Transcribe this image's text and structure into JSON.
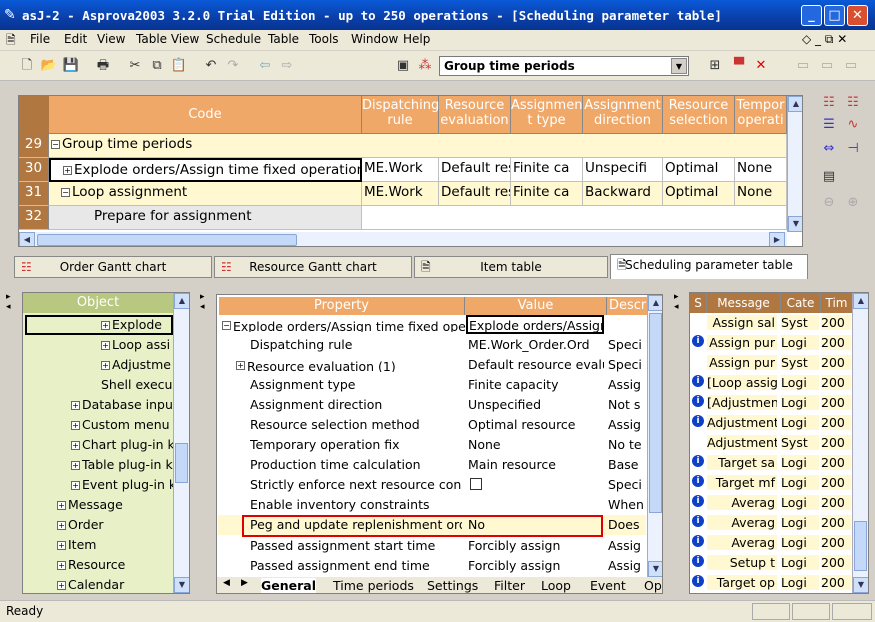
{
  "window": {
    "title": "asJ-2 - Asprova2003 3.2.0 Trial Edition  - up to 250 operations - [Scheduling parameter table]"
  },
  "menu": [
    "File",
    "Edit",
    "View",
    "Table View",
    "Schedule",
    "Table",
    "Tools",
    "Window",
    "Help"
  ],
  "toolbar": {
    "group_select": "Group time periods"
  },
  "top_grid": {
    "headers": [
      "Code",
      "Dispatching rule",
      "Resource evaluation",
      "Assignmen t type",
      "Assignment direction",
      "Resource selection",
      "Tempor operati"
    ],
    "rows": [
      {
        "num": "29",
        "code": "Group time periods",
        "cells": [
          "",
          "",
          "",
          "",
          "",
          ""
        ]
      },
      {
        "num": "30",
        "code": "Explode orders/Assign time fixed operations",
        "cells": [
          "ME.Work",
          "Default res",
          "Finite ca",
          "Unspecifi",
          "Optimal",
          "None"
        ]
      },
      {
        "num": "31",
        "code": "Loop assignment",
        "cells": [
          "ME.Work",
          "Default res",
          "Finite ca",
          "Backward",
          "Optimal",
          "None"
        ]
      },
      {
        "num": "32",
        "code": "Prepare for assignment",
        "cells": [
          "",
          "",
          "",
          "",
          "",
          ""
        ]
      }
    ]
  },
  "tabs": [
    "Order Gantt chart",
    "Resource Gantt chart",
    "Item table",
    "Scheduling parameter table"
  ],
  "object_tree": {
    "header": "Object",
    "items": [
      "Explode",
      "Loop assi",
      "Adjustme",
      "Shell execu",
      "Database inpu",
      "Custom menu",
      "Chart plug-in k",
      "Table plug-in k",
      "Event plug-in k",
      "Message",
      "Order",
      "Item",
      "Resource",
      "Calendar"
    ]
  },
  "property_grid": {
    "headers": [
      "Property",
      "Value",
      "Descr"
    ],
    "rows": [
      {
        "prop": "Explode orders/Assign time fixed opera",
        "value": "Explode orders/Assign",
        "desc": ""
      },
      {
        "prop": "Dispatching rule",
        "value": "ME.Work_Order.Ord",
        "desc": "Speci"
      },
      {
        "prop": "Resource evaluation (1)",
        "value": "Default resource evalua",
        "desc": "Speci"
      },
      {
        "prop": "Assignment type",
        "value": "Finite capacity",
        "desc": "Assig"
      },
      {
        "prop": "Assignment direction",
        "value": "Unspecified",
        "desc": "Not s"
      },
      {
        "prop": "Resource selection method",
        "value": "Optimal resource",
        "desc": "Assig"
      },
      {
        "prop": "Temporary operation fix",
        "value": "None",
        "desc": "No te"
      },
      {
        "prop": "Production time calculation",
        "value": "Main resource",
        "desc": "Base"
      },
      {
        "prop": "Strictly enforce next resource constr",
        "value": "",
        "desc": "Speci"
      },
      {
        "prop": "Enable inventory constraints",
        "value": "",
        "desc": "When"
      },
      {
        "prop": "Peg and update replenishment order",
        "value": "No",
        "desc": "Does"
      },
      {
        "prop": "Passed assignment start time",
        "value": "Forcibly assign",
        "desc": "Assig"
      },
      {
        "prop": "Passed assignment end time",
        "value": "Forcibly assign",
        "desc": "Assig"
      }
    ],
    "tabs": [
      "General",
      "Time periods",
      "Settings",
      "Filter",
      "Loop",
      "Event",
      "Op"
    ]
  },
  "messages": {
    "headers": [
      "S",
      "Message",
      "Cate",
      "Tim"
    ],
    "rows": [
      {
        "info": false,
        "msg": "Assign sal",
        "cat": "Syst",
        "time": "200"
      },
      {
        "info": true,
        "msg": "Assign pur",
        "cat": "Logi",
        "time": "200"
      },
      {
        "info": false,
        "msg": "Assign pur",
        "cat": "Syst",
        "time": "200"
      },
      {
        "info": true,
        "msg": "[Loop assig",
        "cat": "Logi",
        "time": "200"
      },
      {
        "info": true,
        "msg": "[Adjustmen",
        "cat": "Logi",
        "time": "200"
      },
      {
        "info": true,
        "msg": "Adjustment",
        "cat": "Logi",
        "time": "200"
      },
      {
        "info": false,
        "msg": "Adjustment",
        "cat": "Syst",
        "time": "200"
      },
      {
        "info": true,
        "msg": "Target sa",
        "cat": "Logi",
        "time": "200"
      },
      {
        "info": true,
        "msg": "Target mf",
        "cat": "Logi",
        "time": "200"
      },
      {
        "info": true,
        "msg": "Averag",
        "cat": "Logi",
        "time": "200"
      },
      {
        "info": true,
        "msg": "Averag",
        "cat": "Logi",
        "time": "200"
      },
      {
        "info": true,
        "msg": "Averag",
        "cat": "Logi",
        "time": "200"
      },
      {
        "info": true,
        "msg": "Setup t",
        "cat": "Logi",
        "time": "200"
      },
      {
        "info": true,
        "msg": "Target op",
        "cat": "Logi",
        "time": "200"
      }
    ]
  },
  "status": {
    "text": "Ready"
  }
}
